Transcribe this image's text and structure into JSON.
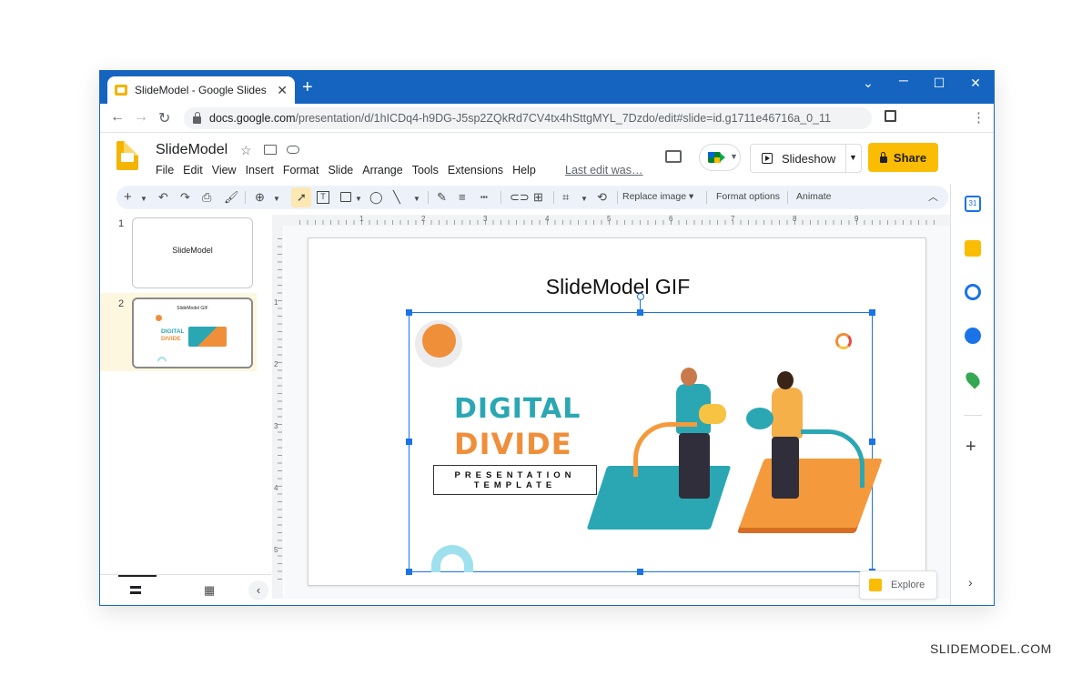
{
  "browser": {
    "tab_title": "SlideModel - Google Slides",
    "new_tab": "+",
    "address_host": "docs.google.com",
    "address_path": "/presentation/d/1hICDq4-h9DG-J5sp2ZQkRd7CV4tx4hSttgMYL_7Dzdo/edit#slide=id.g1711e46716a_0_11",
    "window_controls": [
      "minimize",
      "maximize",
      "close"
    ]
  },
  "app": {
    "doc_title": "SlideModel",
    "menus": [
      "File",
      "Edit",
      "View",
      "Insert",
      "Format",
      "Slide",
      "Arrange",
      "Tools",
      "Extensions",
      "Help"
    ],
    "last_edit": "Last edit was…",
    "slideshow_label": "Slideshow",
    "share_label": "Share",
    "colors": {
      "accent": "#1a73e8",
      "share": "#fbbc04",
      "titlebar": "#1565c0"
    }
  },
  "toolbar": {
    "replace_image": "Replace image",
    "format_options": "Format options",
    "animate": "Animate"
  },
  "ruler": {
    "h_labels": [
      "1",
      "2",
      "3",
      "4",
      "5",
      "6",
      "7",
      "8",
      "9"
    ],
    "v_labels": [
      "1",
      "2",
      "3",
      "4",
      "5"
    ]
  },
  "filmstrip": {
    "slides": [
      {
        "number": "1",
        "title": "SlideModel"
      },
      {
        "number": "2",
        "title": "SlideModel GIF",
        "line1": "DIGITAL",
        "line2": "DIVIDE"
      }
    ]
  },
  "slide": {
    "title": "SlideModel GIF",
    "headline1": "DIGITAL",
    "headline2": "DIVIDE",
    "subline1": "PRESENTATION",
    "subline2": "TEMPLATE"
  },
  "explore_label": "Explore",
  "watermark": "SLIDEMODEL.COM"
}
